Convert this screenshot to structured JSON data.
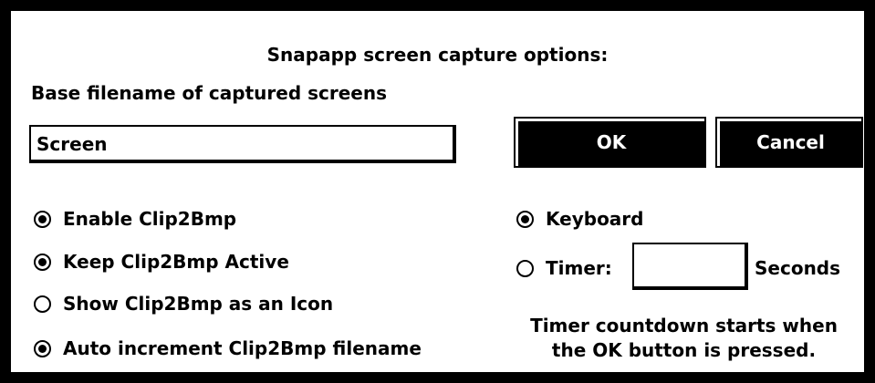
{
  "dialog": {
    "title": "Snapapp screen capture options:",
    "base_filename_label": "Base filename of captured screens",
    "filename_value": "Screen",
    "ok_label": "OK",
    "cancel_label": "Cancel",
    "options": [
      {
        "label": "Enable Clip2Bmp",
        "checked": true
      },
      {
        "label": "Keep Clip2Bmp Active",
        "checked": true
      },
      {
        "label": "Show Clip2Bmp as an Icon",
        "checked": false
      },
      {
        "label": "Auto increment Clip2Bmp filename",
        "checked": true
      }
    ],
    "trigger": [
      {
        "label": "Keyboard",
        "checked": true
      },
      {
        "label": "Timer:",
        "checked": false
      }
    ],
    "timer_value": "",
    "seconds_label": "Seconds",
    "note_line1": "Timer countdown starts when",
    "note_line2": "the OK button is pressed."
  }
}
